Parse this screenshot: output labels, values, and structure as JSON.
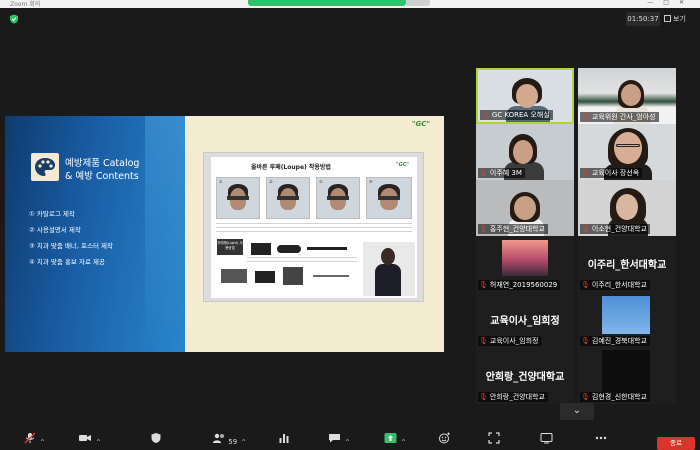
{
  "window": {
    "title": "Zoom 회의"
  },
  "header": {
    "timer": "01:50:37",
    "view_label": "보기"
  },
  "slide": {
    "title_line1": "예방제품 Catalog",
    "title_line2": "& 예방 Contents",
    "bullets": [
      "① 카탈로그 제작",
      "② 사용설명서 제작",
      "③ 치과 맞춤 배너, 포스터 제작",
      "④ 치과 맞춤 홍보 자료 제공"
    ],
    "logo": "\"GC\"",
    "poster_title": "올바른 루페(Loupe) 착용방법",
    "poster_logo": "\"GC\"",
    "poster_box": "귀에형(Light)\n사용방법"
  },
  "participants": [
    {
      "name": "GC KOREA 오해실",
      "active": true
    },
    {
      "name": "교육위원 간사_엄아성"
    },
    {
      "name": "이주혜 3M"
    },
    {
      "name": "교육이사 장선옥"
    },
    {
      "name": "홍주현_건양대학교"
    },
    {
      "name": "이소현_건양대학교"
    },
    {
      "name": "허재연_2019560029"
    },
    {
      "name": "이주리_한서대학교",
      "display": "이주리_한서대학교"
    },
    {
      "name": "교육이사_임희정",
      "display": "교육이사_임희정"
    },
    {
      "name": "김예진_경북대학교"
    },
    {
      "name": "안희랑_건양대학교",
      "display": "안희랑_건양대학교"
    },
    {
      "name": "김현경_신한대학교"
    }
  ],
  "toolbar": {
    "participants_count": "59",
    "end_label": "종료"
  },
  "colors": {
    "accent_green": "#2ec26b",
    "active_border": "#b4d43b",
    "end_red": "#d9362b"
  }
}
